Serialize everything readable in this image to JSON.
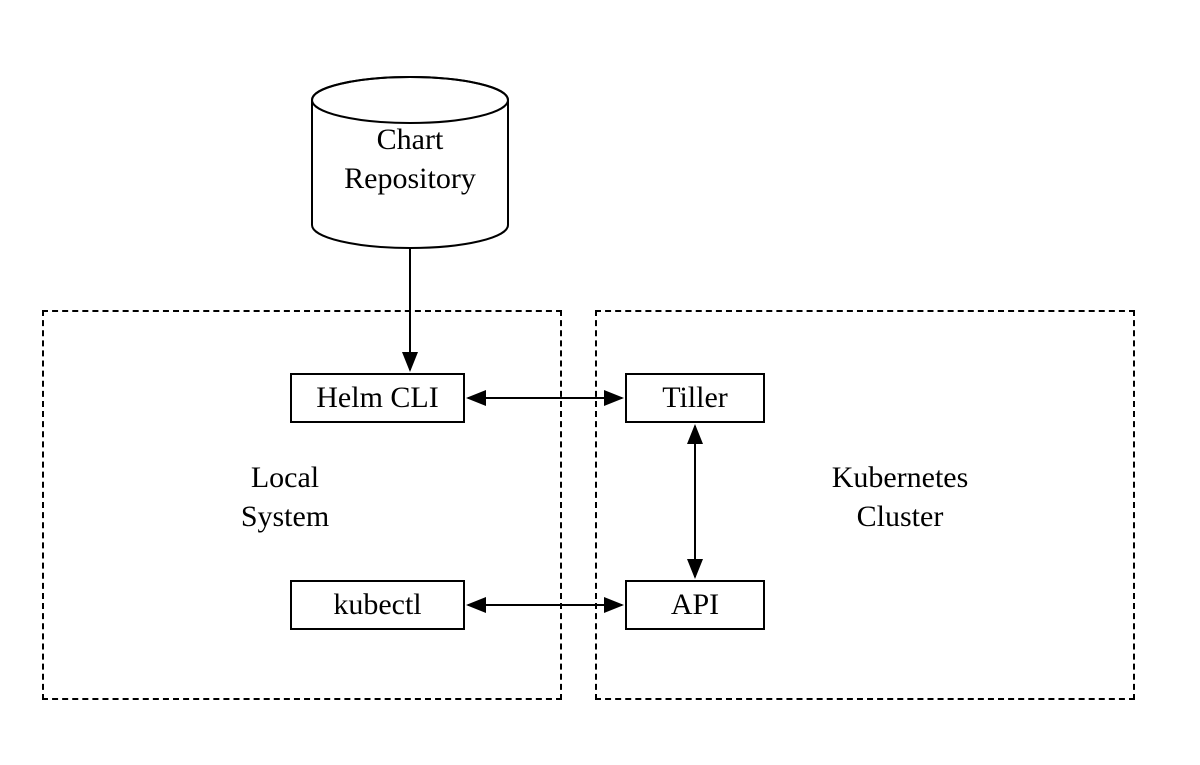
{
  "diagram": {
    "chart_repository": {
      "line1": "Chart",
      "line2": "Repository"
    },
    "local_system": {
      "label_line1": "Local",
      "label_line2": "System",
      "components": {
        "helm_cli": "Helm CLI",
        "kubectl": "kubectl"
      }
    },
    "kubernetes_cluster": {
      "label_line1": "Kubernetes",
      "label_line2": "Cluster",
      "components": {
        "tiller": "Tiller",
        "api": "API"
      }
    },
    "connections": [
      {
        "from": "chart_repository",
        "to": "helm_cli",
        "bidirectional": false
      },
      {
        "from": "helm_cli",
        "to": "tiller",
        "bidirectional": true
      },
      {
        "from": "kubectl",
        "to": "api",
        "bidirectional": true
      },
      {
        "from": "tiller",
        "to": "api",
        "bidirectional": true
      }
    ]
  }
}
